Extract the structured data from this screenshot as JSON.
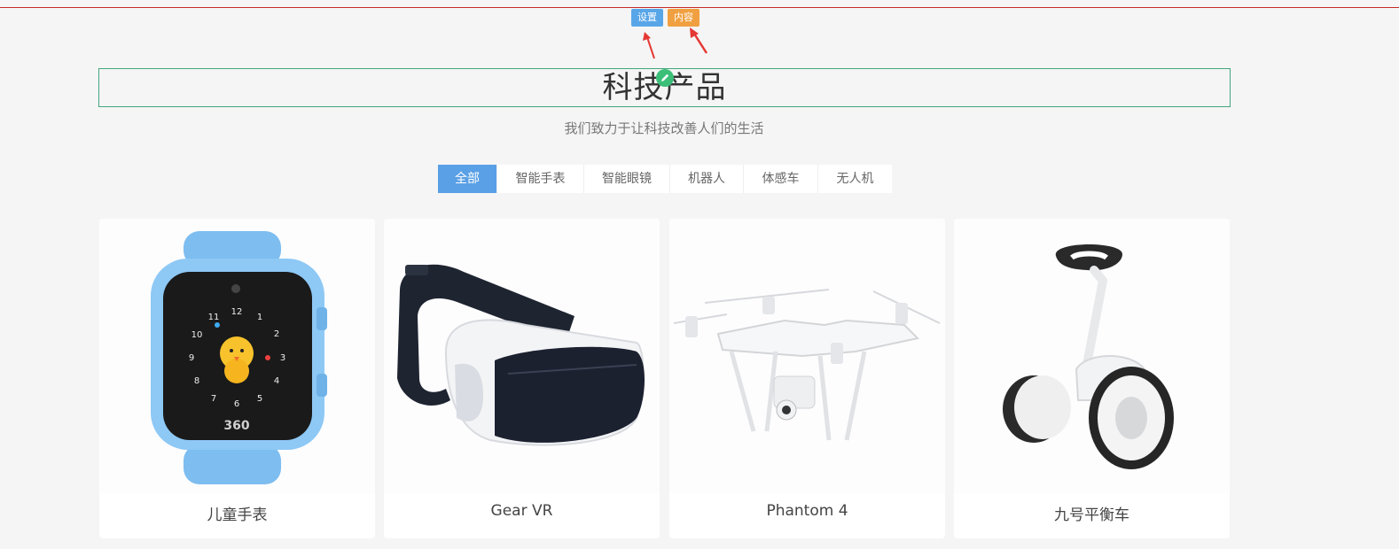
{
  "editor": {
    "settings_label": "设置",
    "content_label": "内容"
  },
  "section": {
    "title": "科技产品",
    "subtitle": "我们致力于让科技改善人们的生活"
  },
  "tabs": [
    {
      "label": "全部",
      "active": true
    },
    {
      "label": "智能手表",
      "active": false
    },
    {
      "label": "智能眼镜",
      "active": false
    },
    {
      "label": "机器人",
      "active": false
    },
    {
      "label": "体感车",
      "active": false
    },
    {
      "label": "无人机",
      "active": false
    }
  ],
  "products": [
    {
      "name": "儿童手表",
      "icon": "kids-smartwatch-image"
    },
    {
      "name": "Gear VR",
      "icon": "vr-headset-image"
    },
    {
      "name": "Phantom 4",
      "icon": "drone-image"
    },
    {
      "name": "九号平衡车",
      "icon": "balance-scooter-image"
    }
  ],
  "colors": {
    "settings_button": "#58a6e8",
    "content_button": "#f0a040",
    "active_tab": "#5aa0e6",
    "title_border": "#43a57d",
    "edit_icon": "#3bbf78",
    "top_line": "#c62828"
  }
}
